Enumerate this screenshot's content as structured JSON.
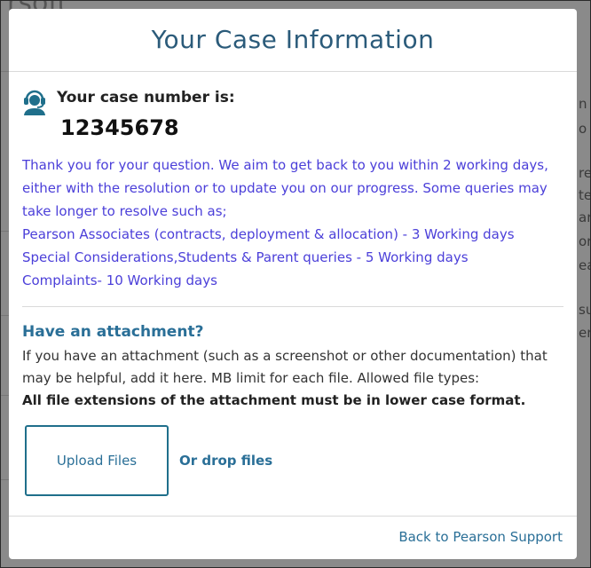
{
  "background": {
    "title_fragment": "rsoft",
    "right_fragments": [
      "n",
      "o",
      "re",
      "te",
      "ar",
      "orn",
      "ea",
      "su",
      "er"
    ]
  },
  "modal": {
    "title": "Your Case Information",
    "case_label": "Your case number is:",
    "case_number": "12345678",
    "info_lines": [
      "Thank you for your question. We aim to get back to you within 2 working days,",
      "either with the resolution or to update you on our progress. Some queries may",
      "take longer to resolve such as;",
      "Pearson Associates (contracts, deployment & allocation) - 3 Working days",
      "Special Considerations,Students & Parent queries - 5 Working days",
      "Complaints- 10 Working days"
    ],
    "attachment": {
      "title": "Have an attachment?",
      "text_line1": "If you have an attachment (such as a screenshot or other documentation) that",
      "text_line2": "may be helpful, add it here. MB limit for each file. Allowed file types:",
      "bold_note": "All file extensions of the attachment must be in lower case format.",
      "upload_label": "Upload Files",
      "drop_label": "Or drop files"
    },
    "footer_link": "Back to Pearson Support"
  },
  "colors": {
    "accent": "#2a6f97",
    "info_text": "#4b3fd9",
    "overlay": "#8a8a8a",
    "icon": "#1f6f8b"
  },
  "icons": [
    "headset-icon"
  ]
}
